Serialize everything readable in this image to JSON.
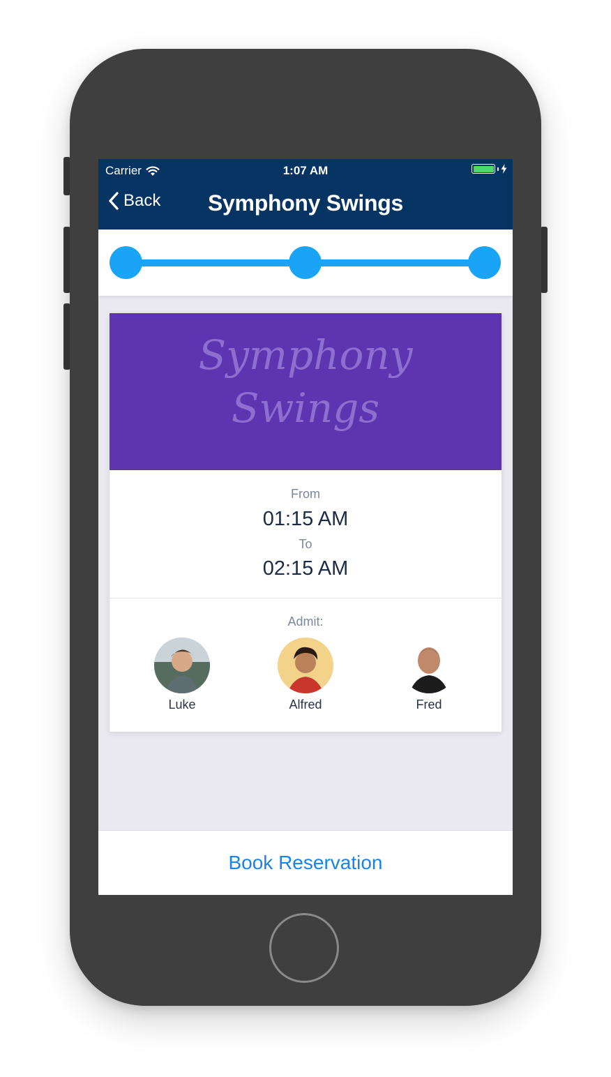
{
  "status_bar": {
    "carrier": "Carrier",
    "time": "1:07 AM",
    "battery_color": "#4cd964"
  },
  "navbar": {
    "back_label": "Back",
    "title": "Symphony Swings",
    "background": "#053362"
  },
  "progress": {
    "steps": 3,
    "accent": "#19a4f7"
  },
  "event": {
    "banner_line1": "Symphony",
    "banner_line2": "Swings",
    "banner_color": "#5e35b1",
    "from_label": "From",
    "from_time": "01:15 AM",
    "to_label": "To",
    "to_time": "02:15 AM",
    "admit_label": "Admit:",
    "guests": [
      {
        "name": "Luke"
      },
      {
        "name": "Alfred"
      },
      {
        "name": "Fred"
      }
    ]
  },
  "footer": {
    "book_label": "Book Reservation",
    "accent": "#1a83e8"
  }
}
